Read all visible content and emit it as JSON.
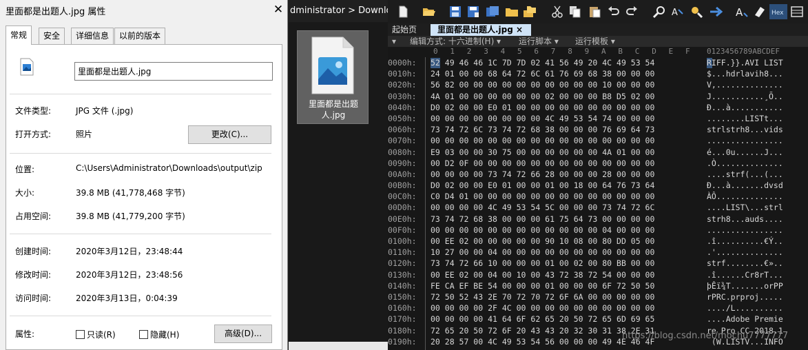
{
  "dialog": {
    "title": "里面都是出题人.jpg 属性",
    "close_glyph": "✕",
    "tabs": [
      "常规",
      "安全",
      "详细信息",
      "以前的版本"
    ],
    "filename": "里面都是出题人.jpg",
    "filetype_label": "文件类型:",
    "filetype_value": "JPG 文件 (.jpg)",
    "openwith_label": "打开方式:",
    "openwith_value": "照片",
    "change_button": "更改(C)...",
    "location_label": "位置:",
    "location_value": "C:\\Users\\Administrator\\Downloads\\output\\zip",
    "size_label": "大小:",
    "size_value": "39.8 MB (41,778,468 字节)",
    "disksize_label": "占用空间:",
    "disksize_value": "39.8 MB (41,779,200 字节)",
    "created_label": "创建时间:",
    "created_value": "2020年3月12日，23:48:44",
    "modified_label": "修改时间:",
    "modified_value": "2020年3月12日，23:48:56",
    "accessed_label": "访问时间:",
    "accessed_value": "2020年3月13日，0:04:39",
    "attributes_label": "属性:",
    "readonly_label": "只读(R)",
    "hidden_label": "隐藏(H)",
    "advanced_button": "高级(D)..."
  },
  "explorer": {
    "address": "dministrator  >  Downloa",
    "file_name": "里面都是出题人.jpg"
  },
  "hex": {
    "tabs": [
      "起始页",
      "里面都是出题人.jpg ×"
    ],
    "menu": [
      "▾",
      "编辑方式: 十六进制(H) ▾",
      "运行脚本 ▾",
      "运行模板 ▾"
    ],
    "col_digits": [
      "0",
      "1",
      "2",
      "3",
      "4",
      "5",
      "6",
      "7",
      "8",
      "9",
      "A",
      "B",
      "C",
      "D",
      "E",
      "F"
    ],
    "ascii_header": "0123456789ABCDEF",
    "watermark": "https://blog.csdn.net/mochu7777777",
    "rows": [
      {
        "off": "0000h:",
        "bytes": "52 49 46 46 1C 7D 7D 02 41 56 49 20 4C 49 53 54",
        "ascii": "RIFF.}}.AVI LIST"
      },
      {
        "off": "0010h:",
        "bytes": "24 01 00 00 68 64 72 6C 61 76 69 68 38 00 00 00",
        "ascii": "$...hdrlavih8..."
      },
      {
        "off": "0020h:",
        "bytes": "56 82 00 00 00 00 00 00 00 00 00 00 10 00 00 00",
        "ascii": "V,.............."
      },
      {
        "off": "0030h:",
        "bytes": "4A 01 00 00 00 00 00 00 02 00 00 00 B8 D5 02 00",
        "ascii": "J...........¸Õ.."
      },
      {
        "off": "0040h:",
        "bytes": "D0 02 00 00 E0 01 00 00 00 00 00 00 00 00 00 00",
        "ascii": "Ð...à..........."
      },
      {
        "off": "0050h:",
        "bytes": "00 00 00 00 00 00 00 00 4C 49 53 54 74 00 00 00",
        "ascii": "........LISTt..."
      },
      {
        "off": "0060h:",
        "bytes": "73 74 72 6C 73 74 72 68 38 00 00 00 76 69 64 73",
        "ascii": "strlstrh8...vids"
      },
      {
        "off": "0070h:",
        "bytes": "00 00 00 00 00 00 00 00 00 00 00 00 00 00 00 00",
        "ascii": "................"
      },
      {
        "off": "0080h:",
        "bytes": "E9 03 00 00 30 75 00 00 00 00 00 00 4A 01 00 00",
        "ascii": "é...0u......J..."
      },
      {
        "off": "0090h:",
        "bytes": "00 D2 0F 00 00 00 00 00 00 00 00 00 00 00 00 00",
        "ascii": ".Ò.............."
      },
      {
        "off": "00A0h:",
        "bytes": "00 00 00 00 73 74 72 66 28 00 00 00 28 00 00 00",
        "ascii": "....strf(...(..."
      },
      {
        "off": "00B0h:",
        "bytes": "D0 02 00 00 E0 01 00 00 01 00 18 00 64 76 73 64",
        "ascii": "Ð...à.......dvsd"
      },
      {
        "off": "00C0h:",
        "bytes": "C0 D4 01 00 00 00 00 00 00 00 00 00 00 00 00 00",
        "ascii": "ÀÔ.............."
      },
      {
        "off": "00D0h:",
        "bytes": "00 00 00 00 4C 49 53 54 5C 00 00 00 73 74 72 6C",
        "ascii": "....LIST\\...strl"
      },
      {
        "off": "00E0h:",
        "bytes": "73 74 72 68 38 00 00 00 61 75 64 73 00 00 00 00",
        "ascii": "strh8...auds...."
      },
      {
        "off": "00F0h:",
        "bytes": "00 00 00 00 00 00 00 00 00 00 00 00 04 00 00 00",
        "ascii": "................"
      },
      {
        "off": "0100h:",
        "bytes": "00 EE 02 00 00 00 00 00 90 10 08 00 80 DD 05 00",
        "ascii": ".î..........€Ý.."
      },
      {
        "off": "0110h:",
        "bytes": "10 27 00 00 04 00 00 00 00 00 00 00 00 00 00 00",
        "ascii": ".'.............."
      },
      {
        "off": "0120h:",
        "bytes": "73 74 72 66 10 00 00 00 01 00 02 00 80 BB 00 00",
        "ascii": "strf........€».."
      },
      {
        "off": "0130h:",
        "bytes": "00 EE 02 00 04 00 10 00 43 72 38 72 54 00 00 00",
        "ascii": ".î......Cr8rT..."
      },
      {
        "off": "0140h:",
        "bytes": "FE CA EF BE 54 00 00 00 01 00 00 00 6F 72 50 50",
        "ascii": "þÊï¾T.......orPP"
      },
      {
        "off": "0150h:",
        "bytes": "72 50 52 43 2E 70 72 70 72 6F 6A 00 00 00 00 00",
        "ascii": "rPRC.prproj....."
      },
      {
        "off": "0160h:",
        "bytes": "00 00 00 00 2F 4C 00 00 00 00 00 00 00 00 00 00",
        "ascii": "..../L.........."
      },
      {
        "off": "0170h:",
        "bytes": "00 00 00 00 41 64 6F 62 65 20 50 72 65 6D 69 65",
        "ascii": "....Adobe Premie"
      },
      {
        "off": "0180h:",
        "bytes": "72 65 20 50 72 6F 20 43 43 20 32 30 31 38 2E 31",
        "ascii": "re Pro CC 2018.1"
      },
      {
        "off": "0190h:",
        "bytes": "20 28 57 00 4C 49 53 54 56 00 00 00 49 4E 46 4F",
        "ascii": " (W.LISTV...INFO"
      }
    ]
  }
}
